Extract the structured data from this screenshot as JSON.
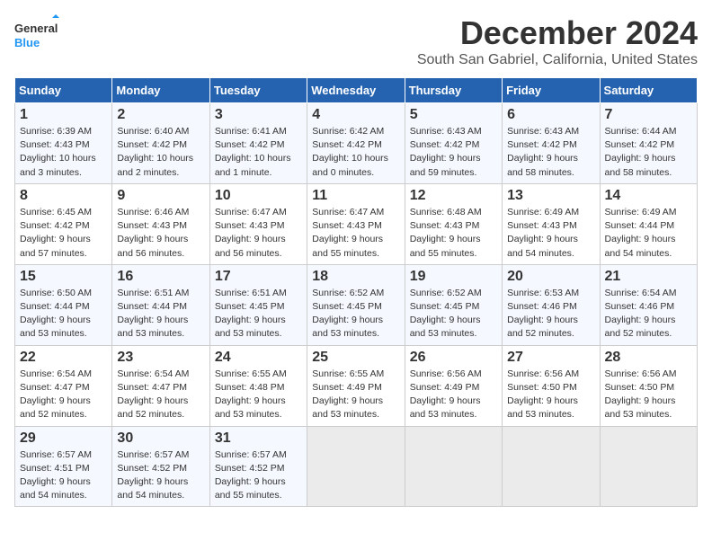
{
  "header": {
    "logo_text_general": "General",
    "logo_text_blue": "Blue",
    "month_title": "December 2024",
    "subtitle": "South San Gabriel, California, United States"
  },
  "days_of_week": [
    "Sunday",
    "Monday",
    "Tuesday",
    "Wednesday",
    "Thursday",
    "Friday",
    "Saturday"
  ],
  "weeks": [
    [
      {
        "day": 1,
        "rise": "6:39 AM",
        "set": "4:43 PM",
        "daylight": "10 hours and 3 minutes."
      },
      {
        "day": 2,
        "rise": "6:40 AM",
        "set": "4:42 PM",
        "daylight": "10 hours and 2 minutes."
      },
      {
        "day": 3,
        "rise": "6:41 AM",
        "set": "4:42 PM",
        "daylight": "10 hours and 1 minute."
      },
      {
        "day": 4,
        "rise": "6:42 AM",
        "set": "4:42 PM",
        "daylight": "10 hours and 0 minutes."
      },
      {
        "day": 5,
        "rise": "6:43 AM",
        "set": "4:42 PM",
        "daylight": "9 hours and 59 minutes."
      },
      {
        "day": 6,
        "rise": "6:43 AM",
        "set": "4:42 PM",
        "daylight": "9 hours and 58 minutes."
      },
      {
        "day": 7,
        "rise": "6:44 AM",
        "set": "4:42 PM",
        "daylight": "9 hours and 58 minutes."
      }
    ],
    [
      {
        "day": 8,
        "rise": "6:45 AM",
        "set": "4:42 PM",
        "daylight": "9 hours and 57 minutes."
      },
      {
        "day": 9,
        "rise": "6:46 AM",
        "set": "4:43 PM",
        "daylight": "9 hours and 56 minutes."
      },
      {
        "day": 10,
        "rise": "6:47 AM",
        "set": "4:43 PM",
        "daylight": "9 hours and 56 minutes."
      },
      {
        "day": 11,
        "rise": "6:47 AM",
        "set": "4:43 PM",
        "daylight": "9 hours and 55 minutes."
      },
      {
        "day": 12,
        "rise": "6:48 AM",
        "set": "4:43 PM",
        "daylight": "9 hours and 55 minutes."
      },
      {
        "day": 13,
        "rise": "6:49 AM",
        "set": "4:43 PM",
        "daylight": "9 hours and 54 minutes."
      },
      {
        "day": 14,
        "rise": "6:49 AM",
        "set": "4:44 PM",
        "daylight": "9 hours and 54 minutes."
      }
    ],
    [
      {
        "day": 15,
        "rise": "6:50 AM",
        "set": "4:44 PM",
        "daylight": "9 hours and 53 minutes."
      },
      {
        "day": 16,
        "rise": "6:51 AM",
        "set": "4:44 PM",
        "daylight": "9 hours and 53 minutes."
      },
      {
        "day": 17,
        "rise": "6:51 AM",
        "set": "4:45 PM",
        "daylight": "9 hours and 53 minutes."
      },
      {
        "day": 18,
        "rise": "6:52 AM",
        "set": "4:45 PM",
        "daylight": "9 hours and 53 minutes."
      },
      {
        "day": 19,
        "rise": "6:52 AM",
        "set": "4:45 PM",
        "daylight": "9 hours and 53 minutes."
      },
      {
        "day": 20,
        "rise": "6:53 AM",
        "set": "4:46 PM",
        "daylight": "9 hours and 52 minutes."
      },
      {
        "day": 21,
        "rise": "6:54 AM",
        "set": "4:46 PM",
        "daylight": "9 hours and 52 minutes."
      }
    ],
    [
      {
        "day": 22,
        "rise": "6:54 AM",
        "set": "4:47 PM",
        "daylight": "9 hours and 52 minutes."
      },
      {
        "day": 23,
        "rise": "6:54 AM",
        "set": "4:47 PM",
        "daylight": "9 hours and 52 minutes."
      },
      {
        "day": 24,
        "rise": "6:55 AM",
        "set": "4:48 PM",
        "daylight": "9 hours and 53 minutes."
      },
      {
        "day": 25,
        "rise": "6:55 AM",
        "set": "4:49 PM",
        "daylight": "9 hours and 53 minutes."
      },
      {
        "day": 26,
        "rise": "6:56 AM",
        "set": "4:49 PM",
        "daylight": "9 hours and 53 minutes."
      },
      {
        "day": 27,
        "rise": "6:56 AM",
        "set": "4:50 PM",
        "daylight": "9 hours and 53 minutes."
      },
      {
        "day": 28,
        "rise": "6:56 AM",
        "set": "4:50 PM",
        "daylight": "9 hours and 53 minutes."
      }
    ],
    [
      {
        "day": 29,
        "rise": "6:57 AM",
        "set": "4:51 PM",
        "daylight": "9 hours and 54 minutes."
      },
      {
        "day": 30,
        "rise": "6:57 AM",
        "set": "4:52 PM",
        "daylight": "9 hours and 54 minutes."
      },
      {
        "day": 31,
        "rise": "6:57 AM",
        "set": "4:52 PM",
        "daylight": "9 hours and 55 minutes."
      },
      null,
      null,
      null,
      null
    ]
  ]
}
